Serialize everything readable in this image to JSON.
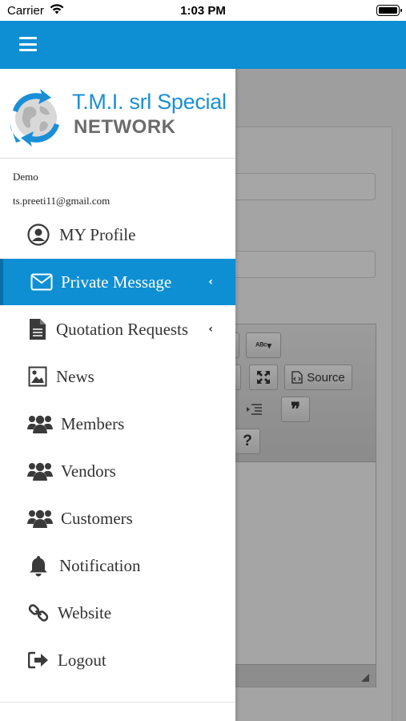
{
  "status_bar": {
    "carrier": "Carrier",
    "time": "1:03 PM"
  },
  "app_bar": {
    "menu_icon": "hamburger-icon",
    "color": "#0e8fd3"
  },
  "logo": {
    "line1": "T.M.I. srl Special",
    "line2": "NETWORK",
    "icon": "globe-arrows-icon"
  },
  "user": {
    "name": "Demo",
    "email": "ts.preeti11@gmail.com"
  },
  "menu": [
    {
      "label": "MY Profile",
      "icon": "user-circle-icon"
    },
    {
      "label": "Private Message",
      "icon": "envelope-icon",
      "active": true,
      "chevron": "‹"
    },
    {
      "label": "Quotation Requests",
      "icon": "document-icon",
      "chevron": "‹"
    },
    {
      "label": "News",
      "icon": "image-icon"
    },
    {
      "label": "Members",
      "icon": "users-icon"
    },
    {
      "label": "Vendors",
      "icon": "users-icon"
    },
    {
      "label": "Customers",
      "icon": "users-icon"
    },
    {
      "label": "Notification",
      "icon": "bell-icon"
    },
    {
      "label": "Website",
      "icon": "link-icon"
    },
    {
      "label": "Logout",
      "icon": "logout-icon"
    }
  ],
  "background_editor": {
    "source_label": "Source",
    "quote_glyph": "❞",
    "help_glyph": "?"
  },
  "colors": {
    "accent": "#0e8fd3",
    "overlay": "#9e9e9e"
  }
}
